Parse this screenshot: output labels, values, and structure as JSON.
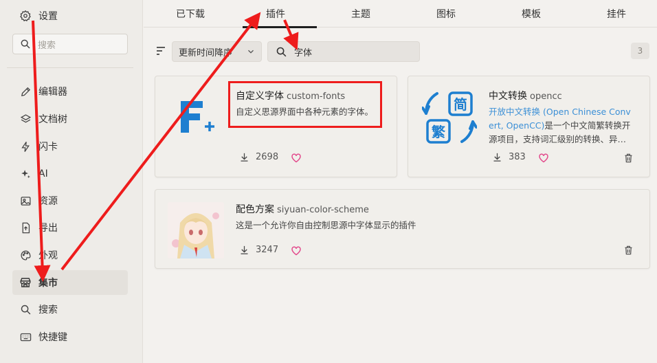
{
  "sidebar": {
    "settings_label": "设置",
    "search_placeholder": "搜索",
    "items": [
      {
        "label": "编辑器",
        "icon": "pencil-icon"
      },
      {
        "label": "文档树",
        "icon": "layers-icon"
      },
      {
        "label": "闪卡",
        "icon": "flash-icon"
      },
      {
        "label": "AI",
        "icon": "sparkle-icon"
      },
      {
        "label": "资源",
        "icon": "image-icon"
      },
      {
        "label": "导出",
        "icon": "export-icon"
      },
      {
        "label": "外观",
        "icon": "palette-icon"
      },
      {
        "label": "集市",
        "icon": "store-icon",
        "active": true
      },
      {
        "label": "搜索",
        "icon": "search-icon"
      },
      {
        "label": "快捷键",
        "icon": "keyboard-icon"
      }
    ]
  },
  "tabs": [
    {
      "label": "已下载"
    },
    {
      "label": "插件",
      "active": true
    },
    {
      "label": "主题"
    },
    {
      "label": "图标"
    },
    {
      "label": "模板"
    },
    {
      "label": "挂件"
    }
  ],
  "toolbar": {
    "sort_value": "更新时间降序",
    "search_value": "字体",
    "result_count": "3"
  },
  "plugins": [
    {
      "name": "自定义字体",
      "package": "custom-fonts",
      "description": "自定义思源界面中各种元素的字体。",
      "downloads": "2698",
      "icon": "custom-fonts-logo-icon"
    },
    {
      "name": "中文转换",
      "package": "opencc",
      "description_link": "开放中文转换 (Open Chinese Convert, OpenCC)",
      "description_line1": "开放中文转换 (Open Chinese Conv",
      "description_line2_link": "ert, OpenCC)",
      "description_line2_rest": "是一个中文简繁转换开",
      "description_line3": "源项目，支持词汇级别的转换、异…",
      "downloads": "383",
      "icon_chars": [
        "简",
        "繁"
      ]
    },
    {
      "name": "配色方案",
      "package": "siyuan-color-scheme",
      "description": "这是一个允许你自由控制思源中字体显示的插件",
      "downloads": "3247",
      "icon": "anime-avatar-icon"
    }
  ],
  "colors": {
    "accent_blue": "#1e7fd0",
    "link_blue": "#3b8fd6",
    "heart_pink": "#e2478a",
    "annotation_red": "#ee1c1c"
  }
}
